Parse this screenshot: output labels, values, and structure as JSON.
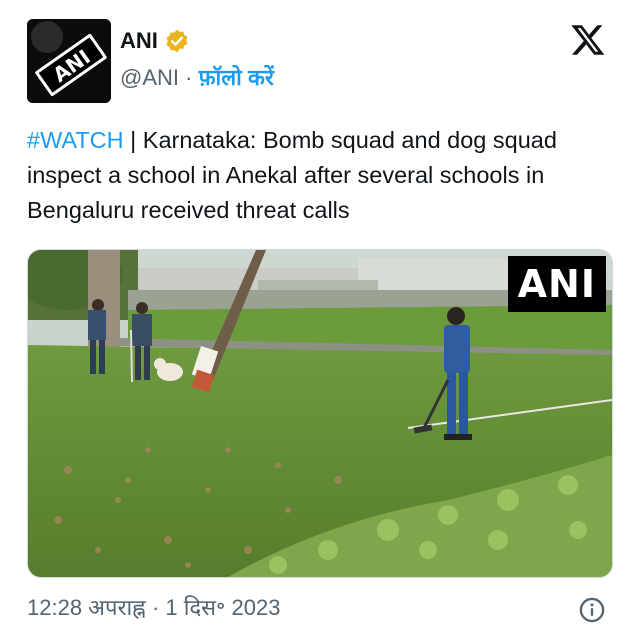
{
  "account": {
    "name": "ANI",
    "handle": "@ANI",
    "separator": "·",
    "follow_label": "फ़ॉलो करें",
    "avatar_text": "ANI",
    "verified_color": "#e8b520"
  },
  "tweet": {
    "hashtag": "#WATCH",
    "text": " | Karnataka: Bomb squad and dog squad inspect a school in Anekal after several schools in Bengaluru received threat calls"
  },
  "media": {
    "watermark": "ANI"
  },
  "footer": {
    "timestamp": "12:28 अपराह्न · 1 दिस॰ 2023"
  },
  "colors": {
    "link": "#1d9bf0",
    "secondary_text": "#536471"
  },
  "icons": [
    "verified-badge-icon",
    "x-logo-icon",
    "info-icon"
  ]
}
